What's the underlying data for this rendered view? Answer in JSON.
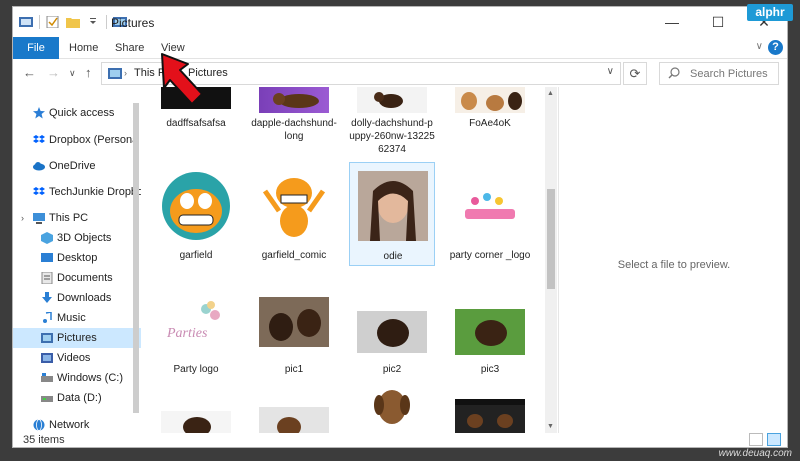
{
  "window": {
    "title": "Pictures",
    "controls": {
      "minimize": "—",
      "maximize": "☐",
      "close": "✕"
    }
  },
  "badge": {
    "text": "alphr"
  },
  "ribbon": {
    "tabs": [
      "File",
      "Home",
      "Share",
      "View"
    ],
    "help": "?"
  },
  "address": {
    "crumbs": [
      "This PC",
      "Pictures"
    ],
    "search_placeholder": "Search Pictures"
  },
  "nav": {
    "items": [
      {
        "label": "Quick access",
        "icon": "star-icon"
      },
      {
        "label": "Dropbox (Persona",
        "icon": "dropbox-icon"
      },
      {
        "label": "OneDrive",
        "icon": "cloud-icon"
      },
      {
        "label": "TechJunkie Dropbo",
        "icon": "dropbox-icon"
      },
      {
        "label": "This PC",
        "icon": "computer-icon"
      },
      {
        "label": "3D Objects",
        "icon": "cube-icon"
      },
      {
        "label": "Desktop",
        "icon": "desktop-icon"
      },
      {
        "label": "Documents",
        "icon": "document-icon"
      },
      {
        "label": "Downloads",
        "icon": "download-icon"
      },
      {
        "label": "Music",
        "icon": "music-icon"
      },
      {
        "label": "Pictures",
        "icon": "pictures-icon"
      },
      {
        "label": "Videos",
        "icon": "video-icon"
      },
      {
        "label": "Windows (C:)",
        "icon": "drive-icon"
      },
      {
        "label": "Data (D:)",
        "icon": "drive-icon"
      },
      {
        "label": "Network",
        "icon": "network-icon"
      }
    ]
  },
  "files": [
    {
      "name": "dadffsafsafsa"
    },
    {
      "name": "dapple-dachshund-long"
    },
    {
      "name": "dolly-dachshund-puppy-260nw-1322562374"
    },
    {
      "name": "FoAe4oK"
    },
    {
      "name": "garfield"
    },
    {
      "name": "garfield_comic"
    },
    {
      "name": "odie"
    },
    {
      "name": "party corner _logo"
    },
    {
      "name": "Party logo"
    },
    {
      "name": "pic1"
    },
    {
      "name": "pic2"
    },
    {
      "name": "pic3"
    },
    {
      "name": ""
    },
    {
      "name": ""
    },
    {
      "name": ""
    },
    {
      "name": ""
    }
  ],
  "preview": {
    "message": "Select a file to preview."
  },
  "status": {
    "count": "35 items"
  },
  "watermark": "www.deuaq.com",
  "colors": {
    "accent": "#1979ca",
    "selection": "#cce8ff",
    "arrow": "#e3101a"
  }
}
